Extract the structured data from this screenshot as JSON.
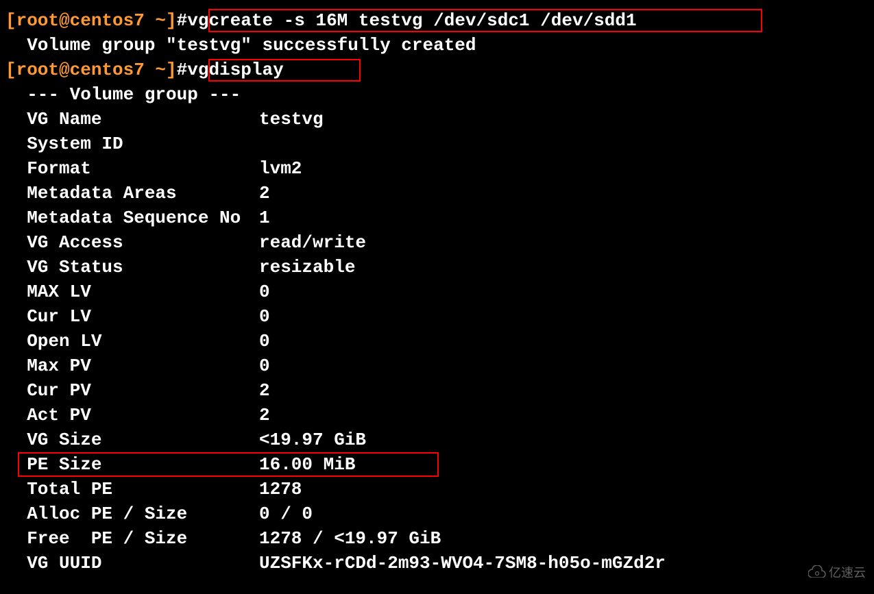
{
  "prompt1": {
    "user": "[root@centos7 ~]",
    "hash": "#",
    "command": "vgcreate -s 16M testvg /dev/sdc1 /dev/sdd1"
  },
  "output1": "  Volume group \"testvg\" successfully created",
  "prompt2": {
    "user": "[root@centos7 ~]",
    "hash": "#",
    "command": "vgdisplay"
  },
  "header": "  --- Volume group ---",
  "fields": [
    {
      "label": "  VG Name",
      "value": "testvg"
    },
    {
      "label": "  System ID",
      "value": ""
    },
    {
      "label": "  Format",
      "value": "lvm2"
    },
    {
      "label": "  Metadata Areas",
      "value": "2"
    },
    {
      "label": "  Metadata Sequence No",
      "value": "1"
    },
    {
      "label": "  VG Access",
      "value": "read/write"
    },
    {
      "label": "  VG Status",
      "value": "resizable"
    },
    {
      "label": "  MAX LV",
      "value": "0"
    },
    {
      "label": "  Cur LV",
      "value": "0"
    },
    {
      "label": "  Open LV",
      "value": "0"
    },
    {
      "label": "  Max PV",
      "value": "0"
    },
    {
      "label": "  Cur PV",
      "value": "2"
    },
    {
      "label": "  Act PV",
      "value": "2"
    },
    {
      "label": "  VG Size",
      "value": "<19.97 GiB"
    },
    {
      "label": "  PE Size",
      "value": "16.00 MiB"
    },
    {
      "label": "  Total PE",
      "value": "1278"
    },
    {
      "label": "  Alloc PE / Size",
      "value": "0 / 0"
    },
    {
      "label": "  Free  PE / Size",
      "value": "1278 / <19.97 GiB"
    },
    {
      "label": "  VG UUID",
      "value": "UZSFKx-rCDd-2m93-WVO4-7SM8-h05o-mGZd2r"
    }
  ],
  "watermark": "亿速云"
}
